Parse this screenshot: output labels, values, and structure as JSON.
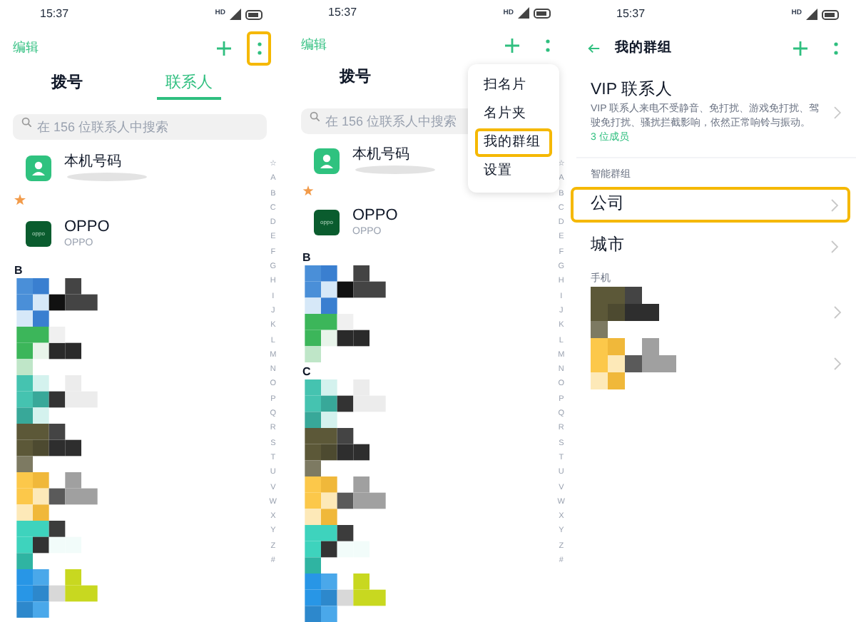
{
  "phones": [
    {
      "kind": "contacts",
      "status_bar": {
        "time": "15:37",
        "network": "HD"
      },
      "edit_label": "编辑",
      "more_highlighted": true,
      "tabs": [
        {
          "label": "拨号",
          "selected": false
        },
        {
          "label": "联系人",
          "selected": true
        }
      ],
      "search": {
        "placeholder": "在 156 位联系人中搜索"
      },
      "my_card": {
        "name": "本机号码"
      },
      "favorites": [
        {
          "name": "OPPO",
          "subtitle": "OPPO",
          "logo_text": "oppo"
        }
      ],
      "sections": [
        {
          "letter": "B",
          "contacts": [
            {
              "kind": "picture"
            },
            {
              "kind": "picture"
            },
            {
              "kind": "picture"
            },
            {
              "kind": "picture"
            },
            {
              "kind": "picture"
            },
            {
              "kind": "picture"
            },
            {
              "kind": "picture"
            }
          ]
        }
      ],
      "index": [
        "☆",
        "A",
        "B",
        "C",
        "D",
        "E",
        "F",
        "G",
        "H",
        "I",
        "J",
        "K",
        "L",
        "M",
        "N",
        "O",
        "P",
        "Q",
        "R",
        "S",
        "T",
        "U",
        "V",
        "W",
        "X",
        "Y",
        "Z",
        "#"
      ]
    },
    {
      "kind": "contacts",
      "status_bar": {
        "time": "15:37",
        "network": "HD"
      },
      "edit_label": "编辑",
      "more_highlighted": false,
      "tabs": [
        {
          "label": "拨号",
          "selected": false
        }
      ],
      "search": {
        "placeholder": "在 156 位联系人中搜索"
      },
      "my_card": {
        "name": "本机号码"
      },
      "favorites": [
        {
          "name": "OPPO",
          "subtitle": "OPPO",
          "logo_text": "oppo"
        }
      ],
      "sections": [
        {
          "letter": "B",
          "contacts": [
            {
              "kind": "picture"
            },
            {
              "kind": "picture"
            }
          ]
        },
        {
          "letter": "C",
          "contacts": [
            {
              "kind": "picture"
            },
            {
              "kind": "picture"
            },
            {
              "kind": "picture"
            },
            {
              "kind": "picture"
            },
            {
              "kind": "picture"
            }
          ]
        }
      ],
      "index": [
        "☆",
        "A",
        "B",
        "C",
        "D",
        "E",
        "F",
        "G",
        "H",
        "I",
        "J",
        "K",
        "L",
        "M",
        "N",
        "O",
        "P",
        "Q",
        "R",
        "S",
        "T",
        "U",
        "V",
        "W",
        "X",
        "Y",
        "Z",
        "#"
      ],
      "menu": [
        {
          "label": "扫名片",
          "highlighted": false
        },
        {
          "label": "名片夹",
          "highlighted": false
        },
        {
          "label": "我的群组",
          "highlighted": true
        },
        {
          "label": "设置",
          "highlighted": false
        }
      ]
    },
    {
      "kind": "groups",
      "status_bar": {
        "time": "15:37",
        "network": "HD"
      },
      "title": "我的群组",
      "more_highlighted": false,
      "vip": {
        "title": "VIP 联系人",
        "description": "VIP 联系人来电不受静音、免打扰、游戏免打扰、驾驶免打扰、骚扰拦截影响，依然正常响铃与振动。",
        "members": "3 位成员"
      },
      "groups_heading": "智能群组",
      "groups": [
        {
          "name": "公司",
          "highlighted": true
        },
        {
          "name": "城市",
          "highlighted": false
        }
      ],
      "phone_heading": "手机",
      "phone_groups": [
        {
          "kind": "picture"
        },
        {
          "kind": "picture"
        }
      ]
    }
  ]
}
